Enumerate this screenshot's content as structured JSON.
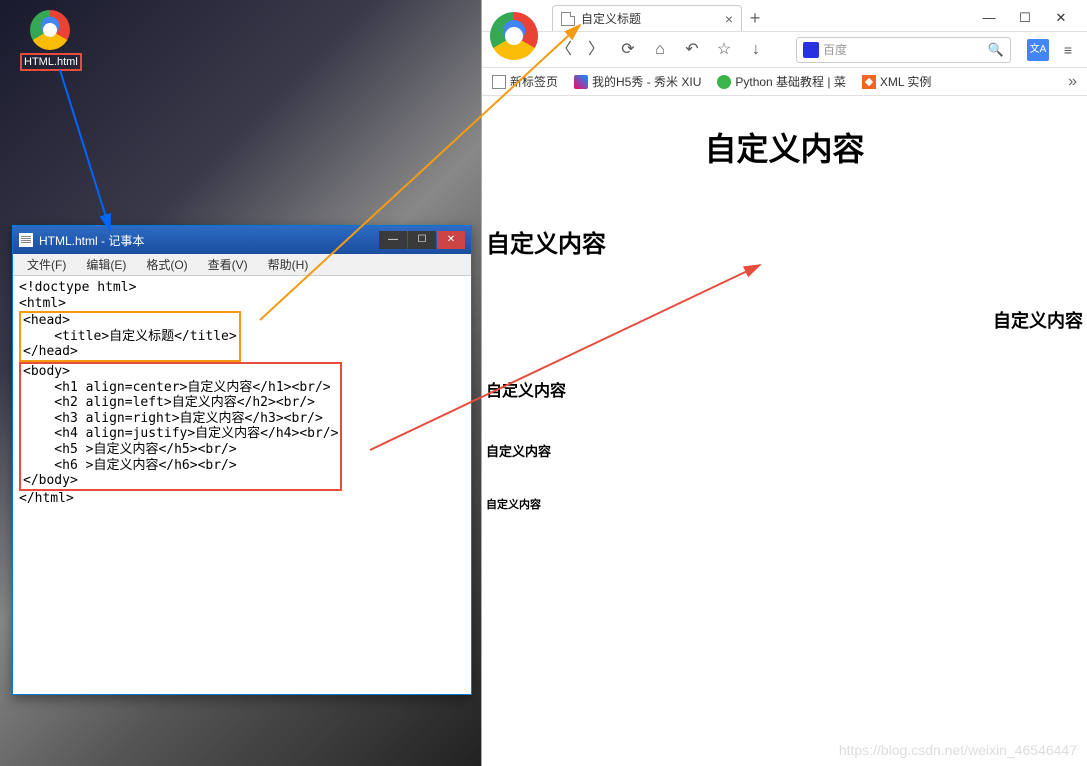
{
  "desktop": {
    "icon_label": "HTML.html"
  },
  "notepad": {
    "title": "HTML.html - 记事本",
    "menu": {
      "file": "文件(F)",
      "edit": "编辑(E)",
      "format": "格式(O)",
      "view": "查看(V)",
      "help": "帮助(H)"
    },
    "code": {
      "doctype": "<!doctype html>",
      "html_open": "<html>",
      "head_open": "<head>",
      "title_line": "    <title>自定义标题</title>",
      "head_close": "</head>",
      "body_open": "<body>",
      "h1": "    <h1 align=center>自定义内容</h1><br/>",
      "h2": "    <h2 align=left>自定义内容</h2><br/>",
      "h3": "    <h3 align=right>自定义内容</h3><br/>",
      "h4": "    <h4 align=justify>自定义内容</h4><br/>",
      "h5": "    <h5 >自定义内容</h5><br/>",
      "h6": "    <h6 >自定义内容</h6><br/>",
      "body_close": "</body>",
      "html_close": "</html>"
    }
  },
  "browser": {
    "tab_title": "自定义标题",
    "address_placeholder": "百度",
    "bookmarks": {
      "b1": "新标签页",
      "b2": "我的H5秀 - 秀米 XIU",
      "b3": "Python 基础教程 | 菜",
      "b4": "XML 实例"
    },
    "content": {
      "h1": "自定义内容",
      "h2": "自定义内容",
      "h3": "自定义内容",
      "h4": "自定义内容",
      "h5": "自定义内容",
      "h6": "自定义内容"
    },
    "watermark": "https://blog.csdn.net/weixin_46546447"
  }
}
